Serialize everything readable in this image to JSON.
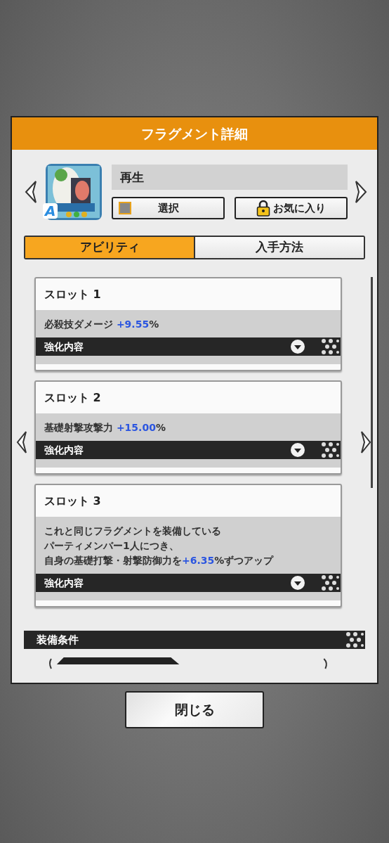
{
  "dialog": {
    "title": "フラグメント詳細"
  },
  "fragment": {
    "name": "再生",
    "rank": "A",
    "select_label": "選択",
    "select_checked": false,
    "favorite_label": "お気に入り",
    "favorite_locked": true
  },
  "tabs": [
    {
      "label": "アビリティ",
      "selected": true
    },
    {
      "label": "入手方法",
      "selected": false
    }
  ],
  "slots": [
    {
      "title": "スロット 1",
      "description": [
        [
          {
            "text": "必殺技ダメージ ",
            "kind": "plain"
          },
          {
            "text": "+9.55",
            "kind": "value"
          },
          {
            "text": "%",
            "kind": "plain"
          }
        ]
      ],
      "expander": "強化内容"
    },
    {
      "title": "スロット 2",
      "description": [
        [
          {
            "text": "基礎射撃攻撃力 ",
            "kind": "plain"
          },
          {
            "text": "+15.00",
            "kind": "value"
          },
          {
            "text": "%",
            "kind": "plain"
          }
        ]
      ],
      "expander": "強化内容"
    },
    {
      "title": "スロット 3",
      "description": [
        [
          {
            "text": "これと同じフラグメントを装備している",
            "kind": "plain"
          }
        ],
        [
          {
            "text": "パーティメンバー1人につき、",
            "kind": "plain"
          }
        ],
        [
          {
            "text": "自身の基礎打撃・射撃防御力を",
            "kind": "plain"
          },
          {
            "text": "+6.35",
            "kind": "value"
          },
          {
            "text": "%ずつアップ",
            "kind": "plain"
          }
        ]
      ],
      "expander": "強化内容"
    }
  ],
  "section": {
    "title": "装備条件"
  },
  "close_button": "閉じる"
}
